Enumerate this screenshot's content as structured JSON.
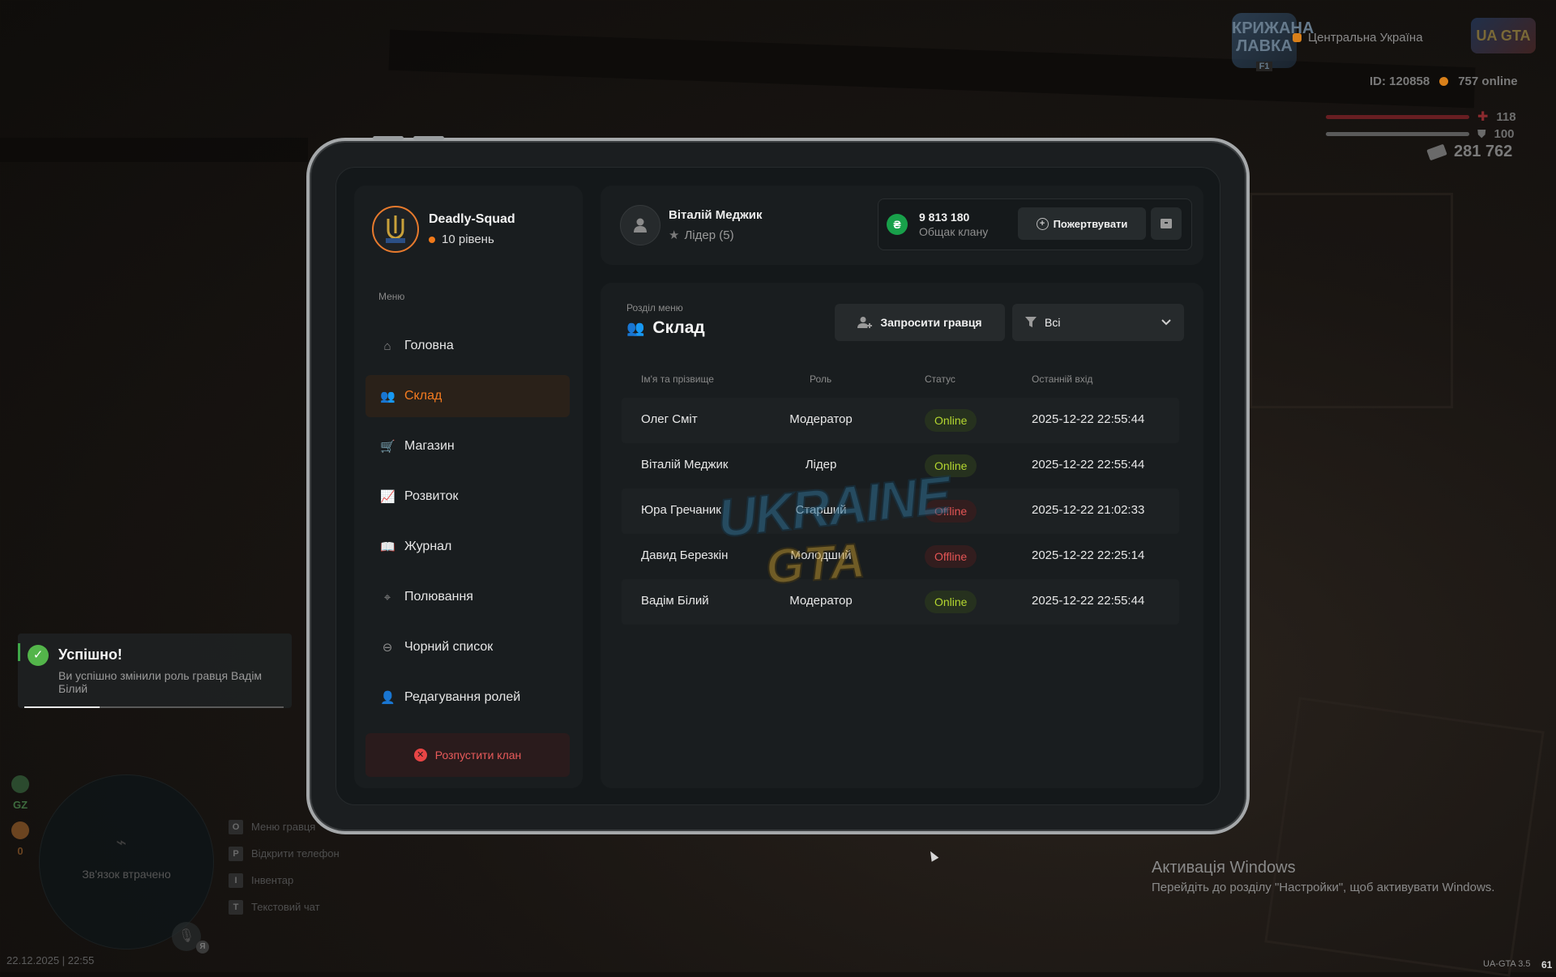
{
  "hud": {
    "server_logo_text": "КРИЖАНА ЛАВКА",
    "server_logo_key": "F1",
    "game_logo_text": "UA GTA",
    "server_name": "Центральна Україна",
    "player_id": "ID: 120858",
    "online": "757 online",
    "health": "118",
    "armor": "100",
    "money": "281 762",
    "health_color": "#a0262e",
    "armor_color": "#5a5a5a"
  },
  "toast": {
    "title": "Успішно!",
    "message": "Ви успішно змінили роль гравця Вадім Білий",
    "progress": 0.29
  },
  "hud_bottom": {
    "side_value_1": "GZ",
    "side_value_2": "0",
    "radar_text": "Зв'язок втрачено",
    "mic_key": "Я",
    "hints": [
      {
        "key": "O",
        "label": "Меню гравця"
      },
      {
        "key": "P",
        "label": "Відкрити телефон"
      },
      {
        "key": "I",
        "label": "Інвентар"
      },
      {
        "key": "T",
        "label": "Текстовий чат"
      }
    ],
    "datetime": "22.12.2025 | 22:55"
  },
  "windows": {
    "title": "Активація Windows",
    "subtitle": "Перейдіть до розділу \"Настройки\", щоб активувати Windows.",
    "version": "UA-GTA 3.5",
    "fps": "61"
  },
  "clan": {
    "name": "Deadly-Squad",
    "level": "10 рівень"
  },
  "menu": {
    "caption": "Меню",
    "items": [
      {
        "label": "Головна",
        "icon": "home-icon",
        "glyph": "⌂"
      },
      {
        "label": "Склад",
        "icon": "members-icon",
        "glyph": "👥"
      },
      {
        "label": "Магазин",
        "icon": "shop-basket-icon",
        "glyph": "🛒"
      },
      {
        "label": "Розвиток",
        "icon": "chart-line-icon",
        "glyph": "📈"
      },
      {
        "label": "Журнал",
        "icon": "book-icon",
        "glyph": "📖"
      },
      {
        "label": "Полювання",
        "icon": "crosshair-icon",
        "glyph": "⌖"
      },
      {
        "label": "Чорний список",
        "icon": "blocked-icon",
        "glyph": "⊖"
      },
      {
        "label": "Редагування ролей",
        "icon": "user-edit-icon",
        "glyph": "👤"
      }
    ],
    "active_index": 1,
    "disband_label": "Розпустити клан"
  },
  "user": {
    "name": "Віталій Меджик",
    "role": "Лідер (5)"
  },
  "bank": {
    "currency_glyph": "₴",
    "amount": "9 813 180",
    "label": "Общак клану",
    "donate_label": "Пожертвувати"
  },
  "section": {
    "caption": "Розділ меню",
    "title": "Склад",
    "invite_label": "Запросити гравця",
    "filter_value": "Всі"
  },
  "table": {
    "columns": [
      "Ім'я та прізвище",
      "Роль",
      "Статус",
      "Останній вхід"
    ],
    "rows": [
      {
        "name": "Олег Сміт",
        "role": "Модератор",
        "status": "Online",
        "last": "2025-12-22 22:55:44"
      },
      {
        "name": "Віталій Меджик",
        "role": "Лідер",
        "status": "Online",
        "last": "2025-12-22 22:55:44"
      },
      {
        "name": "Юра Гречаник",
        "role": "Старший",
        "status": "Offline",
        "last": "2025-12-22 21:02:33"
      },
      {
        "name": "Давид Березкін",
        "role": "Молодший",
        "status": "Offline",
        "last": "2025-12-22 22:25:14"
      },
      {
        "name": "Вадім Білий",
        "role": "Модератор",
        "status": "Online",
        "last": "2025-12-22 22:55:44"
      }
    ]
  },
  "watermark": {
    "line1": "UKRAINE",
    "line2": "GTA"
  },
  "colors": {
    "accent": "#f47b20",
    "online": "#b4d630",
    "offline": "#e45555",
    "bank": "#18a04a",
    "danger": "#e84545"
  }
}
